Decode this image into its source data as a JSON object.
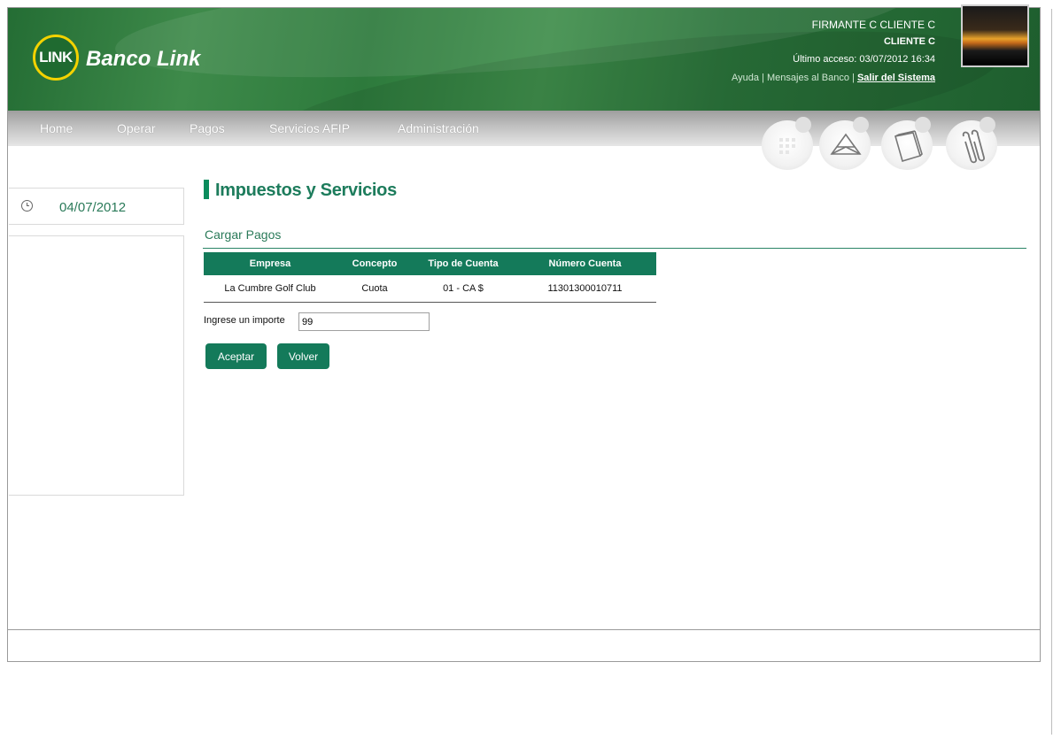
{
  "brand": {
    "logo_text": "LINK",
    "name": "Banco Link"
  },
  "user": {
    "name": "FIRMANTE C CLIENTE C",
    "client": "CLIENTE C",
    "last_access": "Último acceso: 03/07/2012 16:34",
    "links": {
      "help": "Ayuda",
      "sep1": " | ",
      "messages": "Mensajes al Banco",
      "sep2": " | ",
      "logout": "Salir del Sistema"
    }
  },
  "nav": {
    "items": [
      "Home",
      "Operar",
      "Pagos",
      "Servicios AFIP",
      "Administración"
    ]
  },
  "toolbar": {
    "icons": [
      "calculator-icon",
      "envelope-icon",
      "folder-icon",
      "paperclip-icon"
    ]
  },
  "sidebar": {
    "date": "04/07/2012"
  },
  "main": {
    "title": "Impuestos y Servicios",
    "section": "Cargar Pagos",
    "table": {
      "headers": [
        "Empresa",
        "Concepto",
        "Tipo de Cuenta",
        "Número Cuenta"
      ],
      "rows": [
        [
          "La Cumbre Golf Club",
          "Cuota",
          "01 - CA $",
          "11301300010711"
        ]
      ]
    },
    "amount_label": "Ingrese un importe",
    "amount_value": "99",
    "accept_label": "Aceptar",
    "back_label": "Volver"
  },
  "colors": {
    "header_green": "#2d7a3c",
    "accent": "#147a5a",
    "text_green": "#1d7c5c"
  }
}
